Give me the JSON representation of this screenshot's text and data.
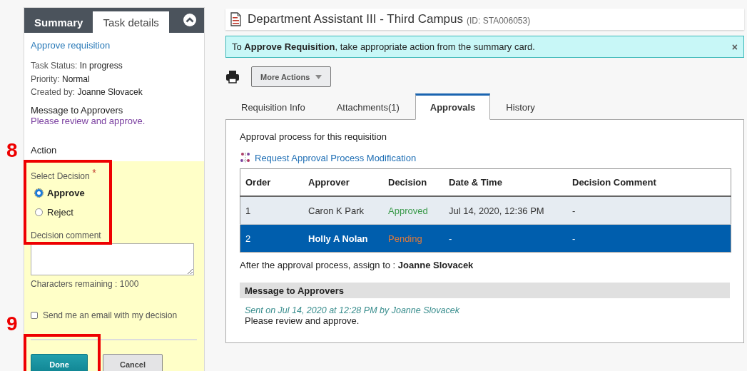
{
  "sidebar": {
    "tabs": [
      {
        "label": "Summary",
        "selected": false
      },
      {
        "label": "Task details",
        "selected": true
      }
    ],
    "task_title": "Approve requisition",
    "details": [
      {
        "label": "Task Status:",
        "value": "In progress"
      },
      {
        "label": "Priority:",
        "value": "Normal"
      },
      {
        "label": "Created by:",
        "value": "Joanne Slovacek"
      }
    ],
    "message_heading": "Message to Approvers",
    "message": "Please review and approve.",
    "action_heading": "Action",
    "decision_label": "Select Decision",
    "required_mark": "*",
    "decisions": [
      {
        "label": "Approve",
        "selected": true
      },
      {
        "label": "Reject",
        "selected": false
      }
    ],
    "comment_label": "Decision comment",
    "chars_remaining": "Characters remaining : 1000",
    "email_option": {
      "label": "Send me an email with my decision",
      "checked": false
    },
    "buttons": [
      {
        "label": "Done",
        "kind": "primary"
      },
      {
        "label": "Cancel",
        "kind": "secondary"
      }
    ]
  },
  "header": {
    "title": "Department Assistant III - Third Campus",
    "id": "(ID: STA006053)"
  },
  "notice": {
    "text": "To **Approve Requisition**, take appropriate action from the summary card.",
    "close": "×"
  },
  "toolbar": {
    "more_actions": "More Actions"
  },
  "tabs": [
    {
      "label": "Requisition Info",
      "selected": false
    },
    {
      "label": "Attachments(1)",
      "selected": false
    },
    {
      "label": "Approvals",
      "selected": true
    },
    {
      "label": "History",
      "selected": false
    }
  ],
  "approvals": {
    "intro": "Approval process for this requisition",
    "modify_link": "Request Approval Process Modification",
    "table": {
      "columns": [
        "Order",
        "Approver",
        "Decision",
        "Date & Time",
        "Decision Comment"
      ],
      "rows": [
        {
          "order": "1",
          "approver": "Caron K Park",
          "decision": "Approved",
          "color": "#3a9a4a",
          "datetime": "Jul 14, 2020, 12:36 PM",
          "comment": "-",
          "selected": false
        },
        {
          "order": "2",
          "approver": "Holly A Nolan",
          "decision": "Pending",
          "color": "#e07a3a",
          "datetime": "-",
          "comment": "-",
          "selected": true
        }
      ]
    },
    "assign": "After the approval process, assign to : **Joanne Slovacek**",
    "message_heading": "Message to Approvers",
    "sent": "Sent on Jul 14, 2020 at 12:28 PM by Joanne Slovacek",
    "message": "Please review and approve."
  },
  "annotations": [
    {
      "label": "8"
    },
    {
      "label": "9"
    }
  ]
}
